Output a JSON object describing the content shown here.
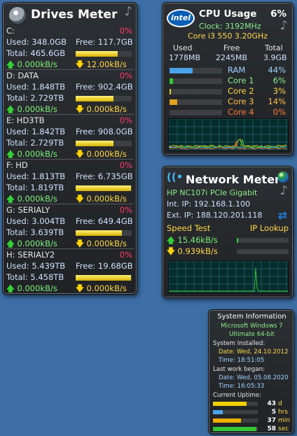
{
  "drives_meter": {
    "title": "Drives Meter",
    "drives": [
      {
        "name": "C:",
        "percent": "0%",
        "used": "Used: 348.0GB",
        "free": "Free: 117.7GB",
        "total": "Total: 465.6GB",
        "read": "0.000kB/s",
        "write": "12.00kB/s",
        "usage_fraction": 0.75
      },
      {
        "name": "D: DATA",
        "percent": "0%",
        "used": "Used: 1.848TB",
        "free": "Free: 902.4GB",
        "total": "Total: 2.729TB",
        "read": "0.000kB/s",
        "write": "0.000kB/s",
        "usage_fraction": 0.68
      },
      {
        "name": "E:  HD3TB",
        "percent": "0%",
        "used": "Used: 1.842TB",
        "free": "Free: 908.0GB",
        "total": "Total: 2.729TB",
        "read": "0.000kB/s",
        "write": "0.000kB/s",
        "usage_fraction": 0.68
      },
      {
        "name": "F:  HD",
        "percent": "0%",
        "used": "Used: 1.813TB",
        "free": "Free: 6.735GB",
        "total": "Total: 1.819TB",
        "read": "0.000kB/s",
        "write": "0.000kB/s",
        "usage_fraction": 0.99
      },
      {
        "name": "G: SERIALY",
        "percent": "0%",
        "used": "Used: 3.004TB",
        "free": "Free: 649.4GB",
        "total": "Total: 3.639TB",
        "read": "0.000kB/s",
        "write": "0.000kB/s",
        "usage_fraction": 0.82
      },
      {
        "name": "H: SERIALY2",
        "percent": "0%",
        "used": "Used: 5.439TB",
        "free": "Free: 19.68GB",
        "total": "Total: 5.458TB",
        "read": "0.000kB/s",
        "write": "0.000kB/s",
        "usage_fraction": 0.99
      }
    ]
  },
  "cpu_usage": {
    "logo": "intel",
    "title": "CPU Usage",
    "usage": "6%",
    "clock": "Clock: 3192MHz",
    "model": "Core i3 550 3.20GHz",
    "headers": [
      "Used",
      "Free",
      "Total"
    ],
    "values": [
      "1778MB",
      "2245MB",
      "3.9GB"
    ],
    "rows": [
      {
        "label": "RAM",
        "percent": "44%",
        "fraction": 0.44,
        "color": "#4aa3e8",
        "label_color": "#9fd2ff"
      },
      {
        "label": "Core 1",
        "percent": "6%",
        "fraction": 0.06,
        "color": "#34c834",
        "label_color": "#8cf08c"
      },
      {
        "label": "Core 2",
        "percent": "3%",
        "fraction": 0.03,
        "color": "#e0d020",
        "label_color": "#ffd84a"
      },
      {
        "label": "Core 3",
        "percent": "14%",
        "fraction": 0.14,
        "color": "#e0a020",
        "label_color": "#ffc04a"
      },
      {
        "label": "Core 4",
        "percent": "0%",
        "fraction": 0.0,
        "color": "#e06020",
        "label_color": "#ff7a3a"
      }
    ]
  },
  "network_meter": {
    "title": "Network Meter",
    "adapter": "HP NC107i PCIe Gigabit",
    "int_ip": "Int. IP: 192.168.1.100",
    "ext_ip": "Ext. IP: 188.120.201.118",
    "speed_test": "Speed Test",
    "ip_lookup": "IP Lookup",
    "upload": "15.46kB/s",
    "download": "0.939kB/s",
    "upload_fraction": 0.03,
    "download_fraction": 0.0
  },
  "system_info": {
    "title": "System Information",
    "os": "Microsoft Windows 7",
    "edition": "Ultimate 64-bit",
    "installed_label": "System Installed:",
    "installed_date": "Date: Wed, 24.10.2012",
    "installed_time": "Time: 18:51:05",
    "lastwork_label": "Last work began:",
    "lastwork_date": "Date: Wed, 05.08.2020",
    "lastwork_time": "Time: 16:05:33",
    "uptime_label": "Current Uptime:",
    "uptime": [
      {
        "value": "43",
        "unit": "d",
        "fraction": 0.75,
        "color": "#f0d000",
        "unit_color": "#ffd84a"
      },
      {
        "value": "5",
        "unit": "hrs",
        "fraction": 0.22,
        "color": "#4aa3e8",
        "unit_color": "#ffd84a"
      },
      {
        "value": "37",
        "unit": "min",
        "fraction": 0.62,
        "color": "#f0b000",
        "unit_color": "#ffd84a"
      },
      {
        "value": "58",
        "unit": "sec",
        "fraction": 0.97,
        "color": "#34c834",
        "unit_color": "#ffd84a"
      }
    ]
  }
}
